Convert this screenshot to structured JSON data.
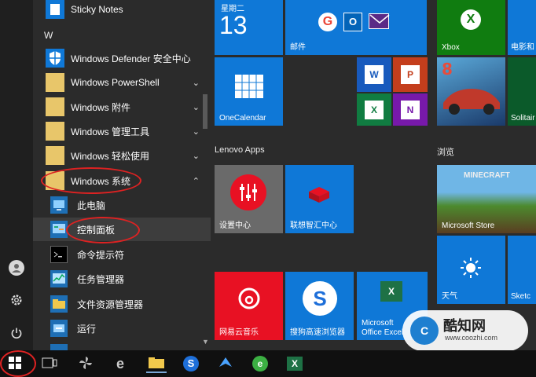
{
  "start_menu": {
    "section_letter": "W",
    "apps": [
      {
        "label": "Sticky Notes"
      },
      {
        "label": "Windows Defender 安全中心"
      },
      {
        "label": "Windows PowerShell"
      },
      {
        "label": "Windows 附件"
      },
      {
        "label": "Windows 管理工具"
      },
      {
        "label": "Windows 轻松使用"
      },
      {
        "label": "Windows 系统"
      },
      {
        "label": "此电脑"
      },
      {
        "label": "控制面板"
      },
      {
        "label": "命令提示符"
      },
      {
        "label": "任务管理器"
      },
      {
        "label": "文件资源管理器"
      },
      {
        "label": "运行"
      }
    ],
    "chevrons": {
      "down": "⌄",
      "up": "⌃"
    }
  },
  "tiles": {
    "calendar": {
      "day_name": "星期二",
      "day_number": "13"
    },
    "mail_label": "邮件",
    "onecalendar_label": "OneCalendar",
    "xbox_label": "Xbox",
    "dianying_label": "电影和",
    "solitaire_label": "Solitair",
    "lenovo_group": "Lenovo Apps",
    "browse_group": "浏览",
    "shezhi_label": "设置中心",
    "lenovo_zhilian_label": "联想智汇中心",
    "minecraft_label": "Microsoft Store",
    "minecraft_banner": "MINECRAFT",
    "weather_label": "天气",
    "sketch_label": "Sketc",
    "wangyi_label": "网易云音乐",
    "sogou_label": "搜狗高速浏览器",
    "office_label_line1": "Microsoft",
    "office_label_line2": "Office Excel",
    "watermark_name": "酷知网",
    "watermark_url": "www.coozhi.com",
    "office_letters": [
      "W",
      "P",
      "X",
      "N"
    ]
  },
  "colors": {
    "tile_blue": "#0f78d7",
    "xbox_green": "#107c10",
    "red": "#e81123",
    "annotation": "#d22"
  }
}
